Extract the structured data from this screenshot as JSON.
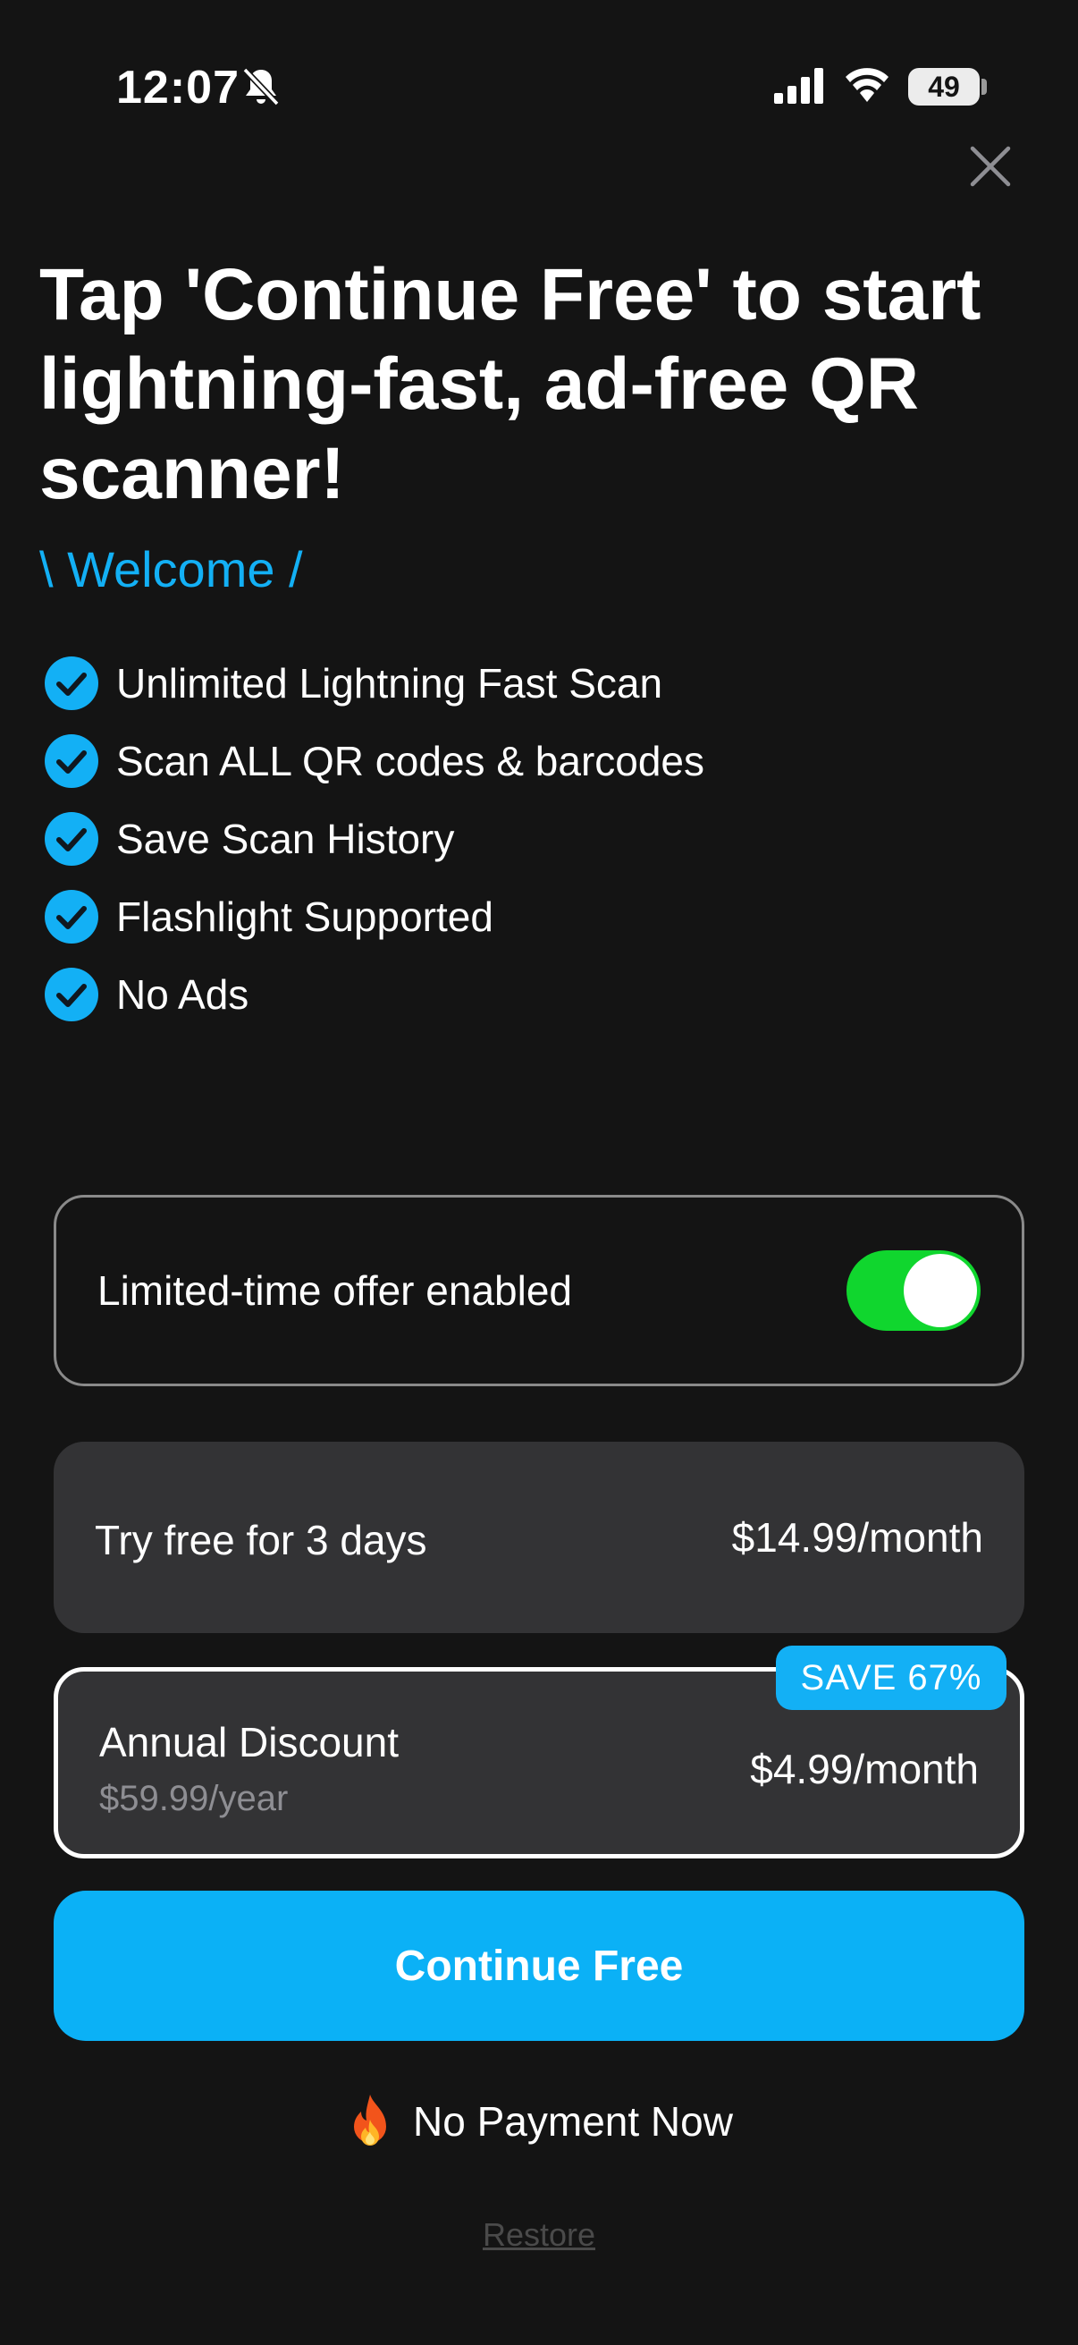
{
  "status_bar": {
    "time": "12:07",
    "battery": "49",
    "icons": [
      "bell-slash-icon",
      "signal-icon",
      "wifi-icon",
      "battery-icon"
    ]
  },
  "header": {
    "close_icon": "close-icon"
  },
  "headline": "Tap 'Continue Free' to start lightning-fast, ad-free QR scanner!",
  "welcome": "\\ Welcome /",
  "features": [
    "Unlimited Lightning Fast Scan",
    "Scan ALL QR codes & barcodes",
    "Save Scan History",
    "Flashlight Supported",
    "No Ads"
  ],
  "offer": {
    "label": "Limited-time offer enabled",
    "enabled": true
  },
  "plans": {
    "monthly": {
      "name": "Try free for 3 days",
      "price": "$14.99/month"
    },
    "annual": {
      "name": "Annual Discount",
      "sub": "$59.99/year",
      "price": "$4.99/month",
      "badge": "SAVE 67%",
      "selected": true
    }
  },
  "cta": {
    "label": "Continue Free"
  },
  "no_payment": {
    "icon": "fire-icon",
    "text": "No Payment Now"
  },
  "restore": "Restore",
  "colors": {
    "background": "#141414",
    "accent": "#0bb1f6",
    "toggle_on": "#10d62e",
    "card": "#333335"
  }
}
